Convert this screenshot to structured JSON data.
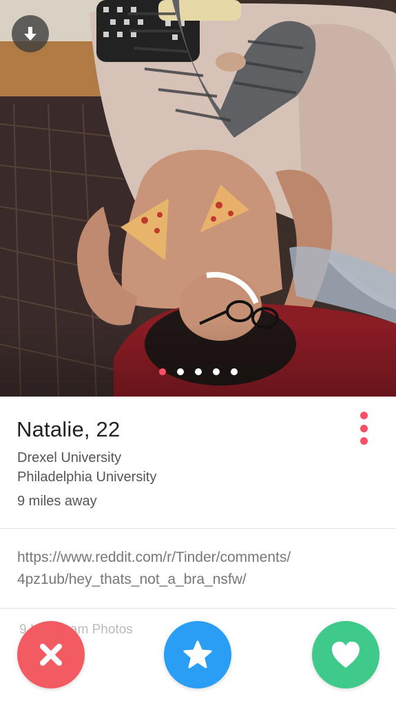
{
  "photo": {
    "description_icon": "profile-photo",
    "page_count": 5,
    "active_page": 1
  },
  "profile": {
    "name_age": "Natalie, 22",
    "school_1": "Drexel University",
    "school_2": "Philadelphia University",
    "distance": "9 miles away"
  },
  "bio": {
    "line_1": "https://www.reddit.com/r/Tinder/comments/",
    "line_2": "4pz1ub/hey_thats_not_a_bra_nsfw/"
  },
  "instagram": {
    "label": "9 Instagram Photos"
  },
  "actions": {
    "nope_icon": "x-icon",
    "super_like_icon": "star-icon",
    "like_icon": "heart-icon"
  },
  "colors": {
    "accent": "#fd5068",
    "nope": "#f15b61",
    "super_like": "#2a9ef5",
    "like": "#3fc98a"
  }
}
